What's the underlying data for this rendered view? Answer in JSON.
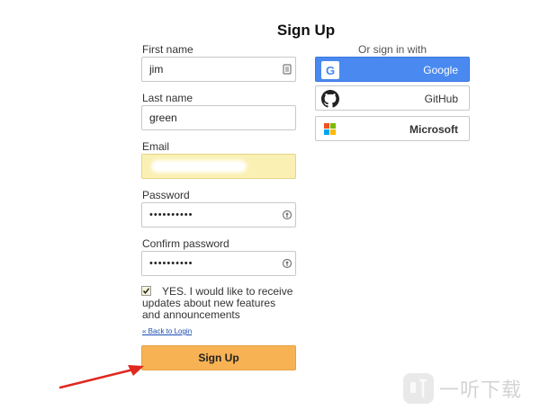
{
  "page_title": "Sign Up",
  "form": {
    "first_name": {
      "label": "First name",
      "value": "jim"
    },
    "last_name": {
      "label": "Last name",
      "value": "green"
    },
    "email": {
      "label": "Email",
      "value": ""
    },
    "password": {
      "label": "Password",
      "value": "••••••••••"
    },
    "confirm_password": {
      "label": "Confirm password",
      "value": "••••••••••"
    },
    "newsletter": {
      "checked": true,
      "label": "YES. I would like to receive updates about new features and announcements"
    },
    "back_link": "« Back to Login",
    "submit_label": "Sign Up"
  },
  "social": {
    "heading": "Or sign in with",
    "providers": [
      {
        "name": "Google",
        "icon": "google-logo-icon",
        "color": "#4a89f0"
      },
      {
        "name": "GitHub",
        "icon": "github-logo-icon"
      },
      {
        "name": "Microsoft",
        "icon": "microsoft-logo-icon"
      }
    ]
  },
  "annotation": {
    "icon": "red-arrow",
    "color": "#e0281e"
  },
  "watermark": {
    "text": "一听下载",
    "icon": "yiting-logo-icon"
  }
}
